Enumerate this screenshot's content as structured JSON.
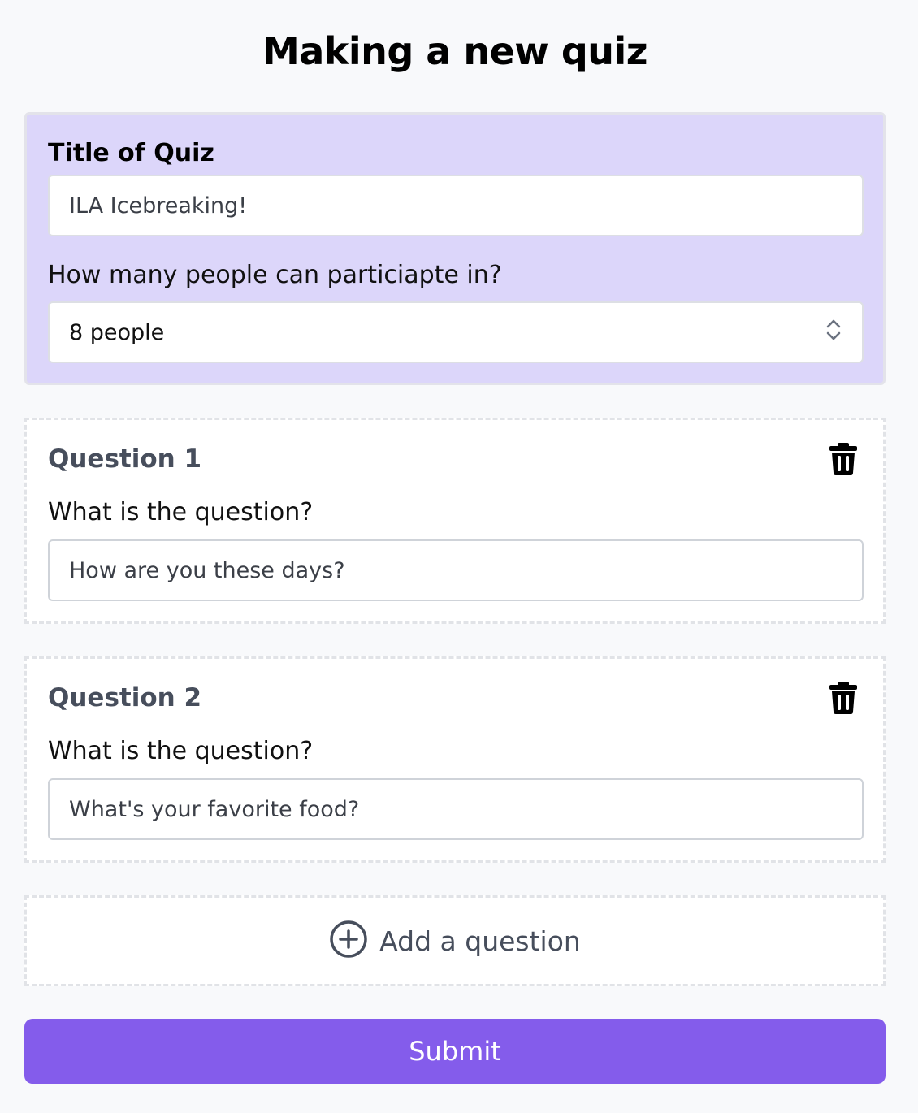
{
  "page": {
    "title": "Making a new quiz"
  },
  "quiz_settings": {
    "title_label": "Title of Quiz",
    "title_value": "ILA Icebreaking!",
    "participants_label": "How many people can particiapte in?",
    "participants_selected": "8 people"
  },
  "questions": [
    {
      "heading": "Question 1",
      "prompt_label": "What is the question?",
      "value": "How are you these days?",
      "delete_icon": "trash-icon"
    },
    {
      "heading": "Question 2",
      "prompt_label": "What is the question?",
      "value": "What's your favorite food?",
      "delete_icon": "trash-icon"
    }
  ],
  "add_question": {
    "label": "Add a question",
    "icon": "plus-circle-icon"
  },
  "submit": {
    "label": "Submit"
  },
  "colors": {
    "settings_background": "#dcd6fa",
    "accent": "#845ceb",
    "question_heading": "#474e5c"
  }
}
